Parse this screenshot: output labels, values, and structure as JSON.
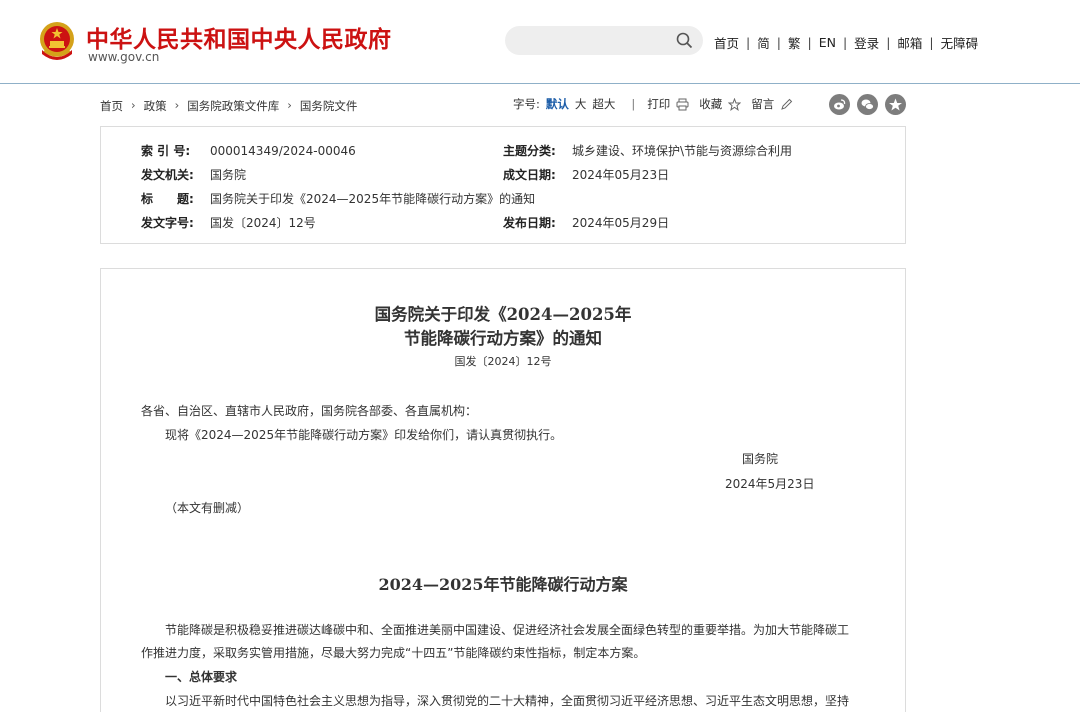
{
  "header": {
    "site_name": "中华人民共和国中央人民政府",
    "site_url": "www.gov.cn",
    "search": {
      "placeholder": ""
    },
    "nav": [
      "首页",
      "简",
      "繁",
      "EN",
      "登录",
      "邮箱",
      "无障碍"
    ],
    "colors": {
      "brand": "#cc1212",
      "accent": "#1b5ca8"
    }
  },
  "breadcrumb": [
    "首页",
    "政策",
    "国务院政策文件库",
    "国务院文件"
  ],
  "tools": {
    "font_size_label": "字号:",
    "font_default": "默认",
    "font_large": "大",
    "font_xlarge": "超大",
    "separator": "|",
    "print": "打印",
    "favorite": "收藏",
    "comment": "留言"
  },
  "share_icons": [
    "weibo-icon",
    "wechat-icon",
    "favorite-star-icon"
  ],
  "info": {
    "index_label": "索 引 号:",
    "index_value": "000014349/2024-00046",
    "topic_label": "主题分类:",
    "topic_value": "城乡建设、环境保护\\节能与资源综合利用",
    "issuer_label": "发文机关:",
    "issuer_value": "国务院",
    "created_label": "成文日期:",
    "created_value": "2024年05月23日",
    "title_label": "标　　题:",
    "title_value": "国务院关于印发《2024—2025年节能降碳行动方案》的通知",
    "docno_label": "发文字号:",
    "docno_value": "国发〔2024〕12号",
    "published_label": "发布日期:",
    "published_value": "2024年05月29日"
  },
  "article": {
    "title_line1": "国务院关于印发《2024—2025年",
    "title_line2": "节能降碳行动方案》的通知",
    "doc_number": "国发〔2024〕12号",
    "salutation": "各省、自治区、直辖市人民政府，国务院各部委、各直属机构：",
    "body1": "现将《2024—2025年节能降碳行动方案》印发给你们，请认真贯彻执行。",
    "signature": "国务院",
    "date": "2024年5月23日",
    "note": "（本文有删减）",
    "plan_title": "2024—2025年节能降碳行动方案",
    "plan_p1_line1": "节能降碳是积极稳妥推进碳达峰碳中和、全面推进美丽中国建设、促进经济社会发展全面绿色转型的重要举措。为加大节能降碳工",
    "plan_p1_line2": "作推进力度，采取务实管用措施，尽最大努力完成“十四五”节能降碳约束性指标，制定本方案。",
    "section1_heading": "一、总体要求",
    "section1_line1": "以习近平新时代中国特色社会主义思想为指导，深入贯彻党的二十大精神，全面贯彻习近平经济思想、习近平生态文明思想，坚持"
  }
}
